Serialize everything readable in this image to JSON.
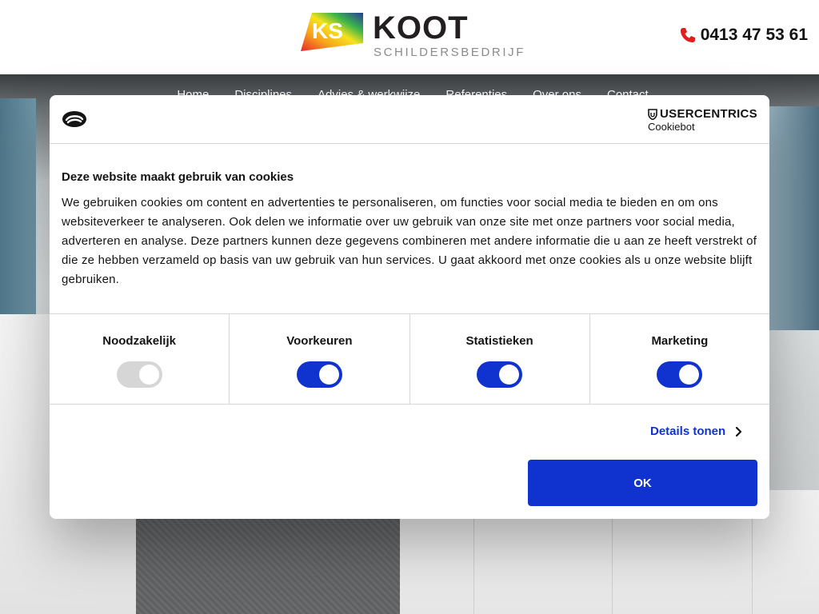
{
  "header": {
    "logo_name": "KOOT",
    "logo_mark": "KS",
    "logo_subtitle": "SCHILDERSBEDRIJF",
    "phone": "0413 47 53 61",
    "phone_icon": "phone-icon"
  },
  "nav": {
    "items": [
      "Home",
      "Disciplines",
      "Advies & werkwijze",
      "Referenties",
      "Over ons",
      "Contact"
    ]
  },
  "cookie_dialog": {
    "brand_top": "USERCENTRICS",
    "brand_bottom": "Cookiebot",
    "title": "Deze website maakt gebruik van cookies",
    "body": "We gebruiken cookies om content en advertenties te personaliseren, om functies voor social media te bieden en om ons websiteverkeer te analyseren. Ook delen we informatie over uw gebruik van onze site met onze partners voor social media, adverteren en analyse. Deze partners kunnen deze gegevens combineren met andere informatie die u aan ze heeft verstrekt of die ze hebben verzameld op basis van uw gebruik van hun services. U gaat akkoord met onze cookies als u onze website blijft gebruiken.",
    "toggles": [
      {
        "label": "Noodzakelijk",
        "on": true,
        "disabled": true
      },
      {
        "label": "Voorkeuren",
        "on": true,
        "disabled": false
      },
      {
        "label": "Statistieken",
        "on": true,
        "disabled": false
      },
      {
        "label": "Marketing",
        "on": true,
        "disabled": false
      }
    ],
    "details_label": "Details tonen",
    "ok_label": "OK",
    "accent_color": "#1032cf"
  }
}
